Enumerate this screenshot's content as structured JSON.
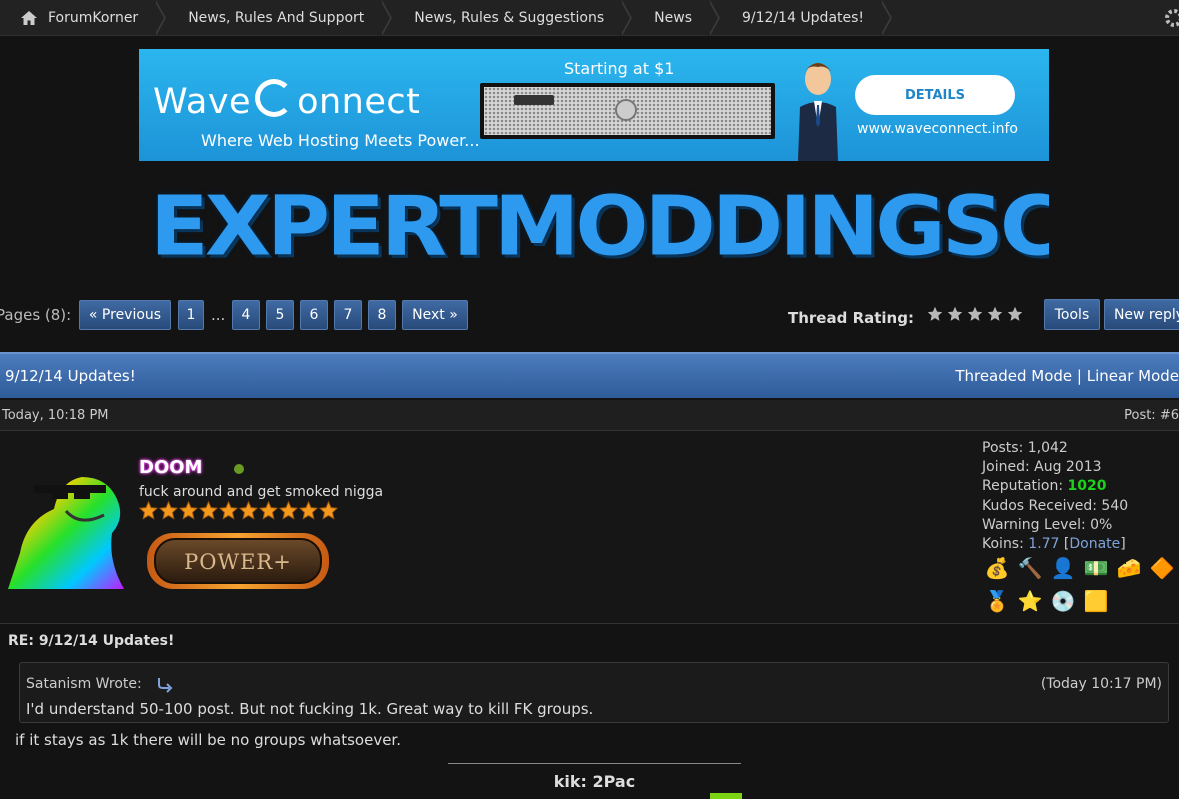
{
  "breadcrumb": [
    "ForumKorner",
    "News, Rules And Support",
    "News, Rules & Suggestions",
    "News",
    "9/12/14 Updates!"
  ],
  "ad": {
    "brand_left": "Wave",
    "brand_right": "onnect",
    "tagline": "Where Web Hosting Meets Power...",
    "starting": "Starting at $1",
    "button": "DETAILS",
    "url": "www.waveconnect.info"
  },
  "site_logo": "EXPERTMODDINGSCENE",
  "pagination": {
    "label": "Pages (8):",
    "previous": "« Previous",
    "pages": [
      "1",
      "4",
      "5",
      "6",
      "7",
      "8"
    ],
    "dots": "...",
    "next": "Next »"
  },
  "rating": {
    "label": "Thread Rating:",
    "stars": 5
  },
  "toolbar": {
    "tools": "Tools",
    "new_reply": "New reply"
  },
  "thread": {
    "title": "9/12/14 Updates!",
    "modes": "Threaded Mode | Linear Mode"
  },
  "post": {
    "date": "Today, 10:18 PM",
    "number": "Post: #6",
    "author": {
      "name": "DOOM",
      "user_title": "fuck around and get smoked nigga",
      "star_count": 10,
      "group": "POWER+"
    },
    "stats": {
      "posts": "Posts: 1,042",
      "joined": "Joined: Aug 2013",
      "reputation_label": "Reputation: ",
      "reputation_value": "1020",
      "kudos": "Kudos Received: 540",
      "warning": "Warning Level: 0%",
      "koins_label": "Koins: ",
      "koins_value": "1.77",
      "donate_open": " [",
      "donate": "Donate",
      "donate_close": "]"
    },
    "subject": "RE: 9/12/14 Updates!",
    "quote": {
      "who": "Satanism Wrote:",
      "time": "(Today 10:17 PM)",
      "text": "I'd understand 50-100 post. But not fucking 1k. Great way to kill FK groups."
    },
    "reply": "if it stays as 1k there will be no groups whatsoever.",
    "signature": "kik: 2Pac"
  },
  "colors": {
    "accent": "#2f5b99",
    "reputation": "#1ad31a",
    "link": "#7fa3d8"
  }
}
